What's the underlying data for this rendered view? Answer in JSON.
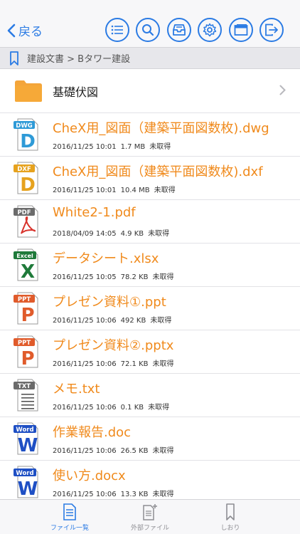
{
  "header": {
    "back_label": "戻る",
    "toolbar_icons": [
      "list-icon",
      "search-icon",
      "inbox-icon",
      "gear-icon",
      "window-icon",
      "logout-icon"
    ]
  },
  "breadcrumb": {
    "path": "建設文書 > Bタワー建設"
  },
  "folders": [
    {
      "name": "基礎伏図"
    }
  ],
  "files": [
    {
      "name": "CheX用_図面（建築平面図数枚).dwg",
      "date": "2016/11/25 10:01",
      "size": "1.7 MB",
      "status": "未取得",
      "badge": "DWG",
      "letter": "D",
      "type": "dwg"
    },
    {
      "name": "CheX用_図面（建築平面図数枚).dxf",
      "date": "2016/11/25 10:01",
      "size": "10.4 MB",
      "status": "未取得",
      "badge": "DXF",
      "letter": "D",
      "type": "dxf"
    },
    {
      "name": "White2-1.pdf",
      "date": "2018/04/09 14:05",
      "size": "4.9 KB",
      "status": "未取得",
      "badge": "PDF",
      "letter": "",
      "type": "pdf"
    },
    {
      "name": "データシート.xlsx",
      "date": "2016/11/25 10:05",
      "size": "78.2 KB",
      "status": "未取得",
      "badge": "Excel",
      "letter": "X",
      "type": "xlsx"
    },
    {
      "name": "プレゼン資料①.ppt",
      "date": "2016/11/25 10:06",
      "size": "492 KB",
      "status": "未取得",
      "badge": "PPT",
      "letter": "P",
      "type": "ppt"
    },
    {
      "name": "プレゼン資料②.pptx",
      "date": "2016/11/25 10:06",
      "size": "72.1 KB",
      "status": "未取得",
      "badge": "PPT",
      "letter": "P",
      "type": "pptx"
    },
    {
      "name": "メモ.txt",
      "date": "2016/11/25 10:06",
      "size": "0.1 KB",
      "status": "未取得",
      "badge": "TXT",
      "letter": "",
      "type": "txt"
    },
    {
      "name": "作業報告.doc",
      "date": "2016/11/25 10:06",
      "size": "26.5 KB",
      "status": "未取得",
      "badge": "Word",
      "letter": "W",
      "type": "doc"
    },
    {
      "name": "使い方.docx",
      "date": "2016/11/25 10:06",
      "size": "13.3 KB",
      "status": "未取得",
      "badge": "Word",
      "letter": "W",
      "type": "docx"
    }
  ],
  "tabs": [
    {
      "label": "ファイル一覧",
      "icon": "document-list-icon",
      "active": true
    },
    {
      "label": "外部ファイル",
      "icon": "external-file-icon",
      "active": false
    },
    {
      "label": "しおり",
      "icon": "bookmark-icon",
      "active": false
    }
  ],
  "colors": {
    "accent": "#2b7be4",
    "filename": "#f08a1c",
    "dwg": "#2e9ad7",
    "dxf": "#e6a21e",
    "pdf": "#d8322b",
    "excel": "#1f7a3a",
    "ppt": "#e05b2b",
    "word": "#1e4fc4",
    "txt": "#555555"
  }
}
